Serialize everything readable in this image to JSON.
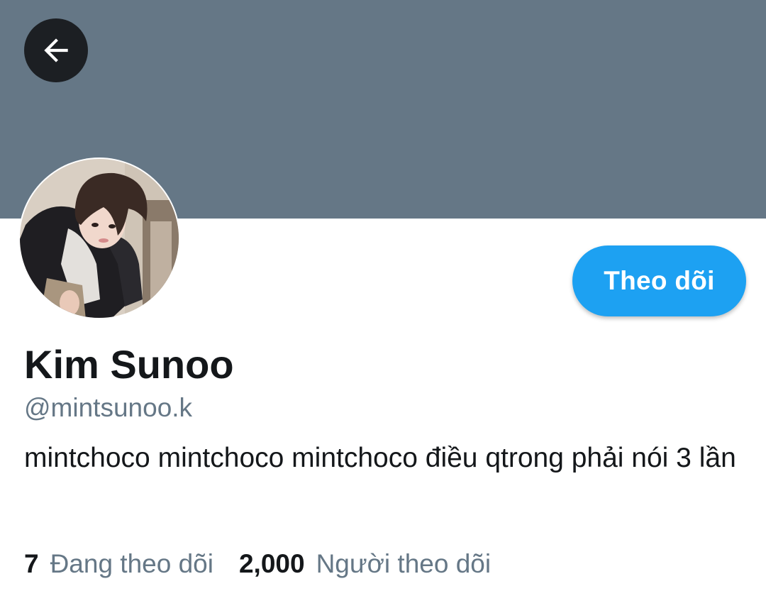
{
  "header": {
    "banner_color": "#657786",
    "back_icon": "arrow-left-icon"
  },
  "profile": {
    "display_name": "Kim Sunoo",
    "handle": "@mintsunoo.k",
    "bio": "mintchoco mintchoco mintchoco điều qtrong phải nói 3 lần",
    "avatar": "profile-photo"
  },
  "actions": {
    "follow_label": "Theo dõi",
    "follow_color": "#1da1f2"
  },
  "stats": {
    "following_count": "7",
    "following_label": "Đang theo dõi",
    "followers_count": "2,000",
    "followers_label": "Người theo dõi"
  }
}
